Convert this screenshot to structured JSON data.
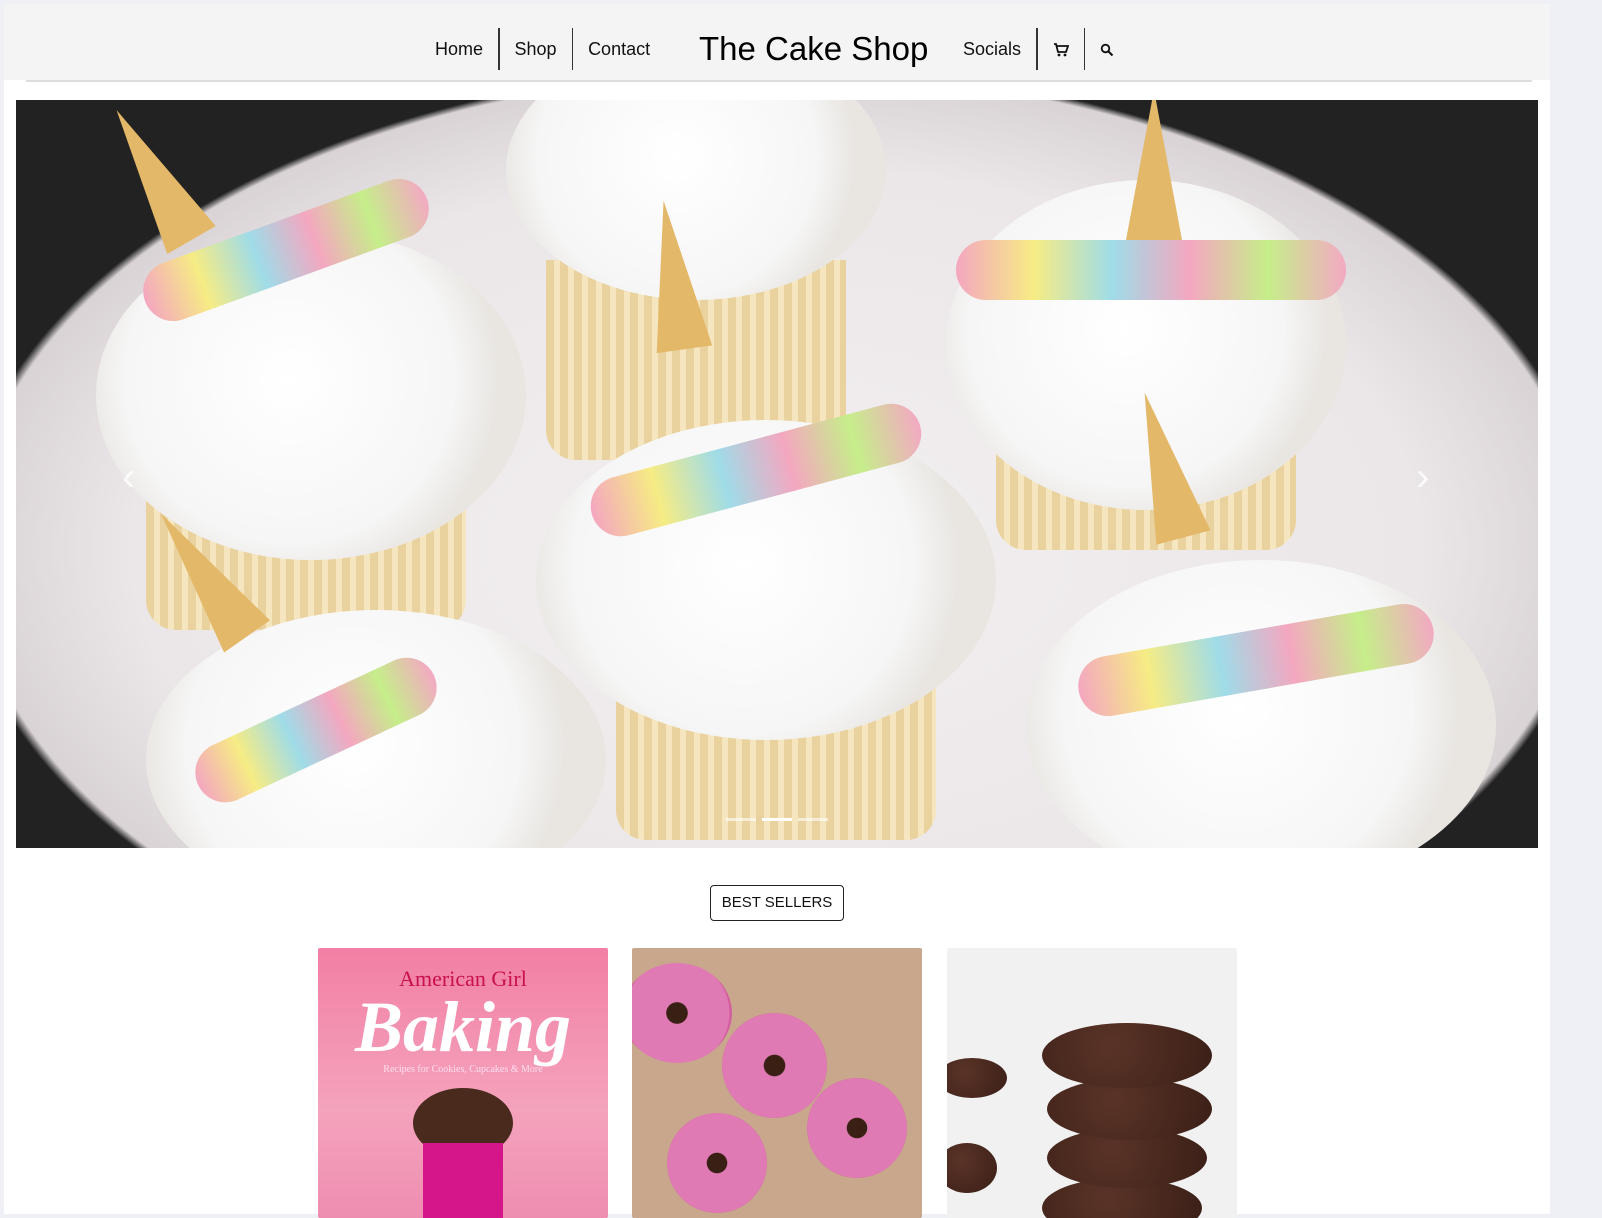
{
  "nav": {
    "left": [
      "Home",
      "Shop",
      "Contact"
    ],
    "brand": "The Cake Shop",
    "right": [
      "Socials"
    ],
    "cart_icon": "cart-icon",
    "search_icon": "search-icon"
  },
  "hero": {
    "prev": "‹",
    "next": "›",
    "slides": 3,
    "active_slide": 2
  },
  "best_sellers": {
    "label": "BEST SELLERS"
  },
  "products": [
    {
      "cover_brand": "American Girl",
      "cover_title": "Baking",
      "cover_subtitle": "Recipes for Cookies, Cupcakes & More"
    },
    {},
    {}
  ]
}
